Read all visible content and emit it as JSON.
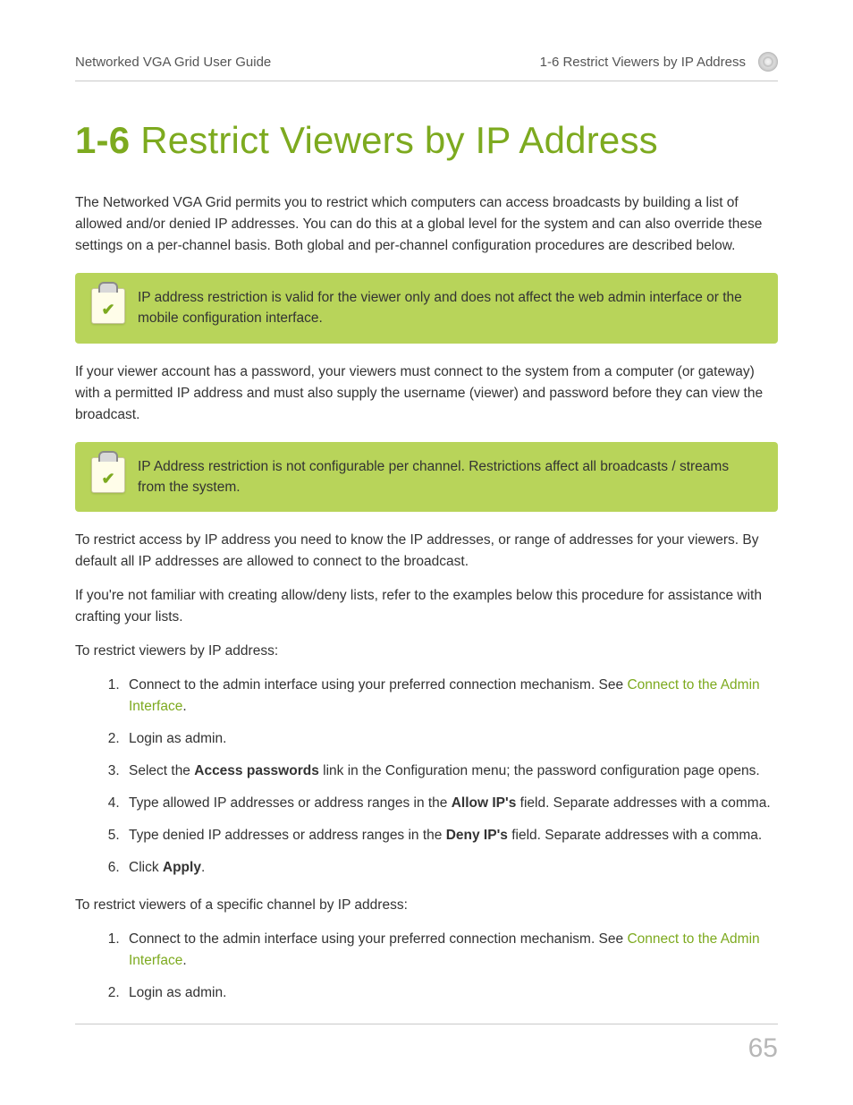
{
  "header": {
    "left": "Networked VGA Grid User Guide",
    "right": "1-6 Restrict Viewers by IP Address"
  },
  "title": {
    "number": "1-6",
    "text": "Restrict Viewers by IP Address"
  },
  "intro": "The Networked VGA Grid permits you to restrict which computers can access broadcasts by building a list of allowed and/or denied IP addresses. You can do this at a global level for the system and can also override these settings on a per-channel basis. Both global and per-channel configuration procedures are described below.",
  "note1": "IP address restriction is valid for the viewer only and does not affect the web admin interface or the mobile configuration interface.",
  "para2": "If your viewer account has a password, your viewers must connect to the system from a computer (or gateway) with a permitted IP address and must also supply the username (viewer) and password before they can view the broadcast.",
  "note2": "IP Address restriction is not configurable per channel. Restrictions affect all broadcasts / streams from the system.",
  "para3": "To restrict access by IP address you need to know the IP addresses, or range of addresses for your viewers. By default all IP addresses are allowed to connect to the broadcast.",
  "para4": "If you're not familiar with creating allow/deny lists, refer to the examples below this procedure for assistance with crafting your lists.",
  "lead1": "To restrict viewers by IP address:",
  "list1": {
    "i1a": "Connect to the admin interface using your preferred connection mechanism. See ",
    "i1link": "Connect to the Admin Interface",
    "i1b": ".",
    "i2": "Login as admin.",
    "i3a": "Select the ",
    "i3b": "Access passwords",
    "i3c": " link in the Configuration menu; the password configuration page opens.",
    "i4a": "Type allowed IP addresses or address ranges in the ",
    "i4b": "Allow IP's",
    "i4c": " field. Separate addresses with a comma.",
    "i5a": "Type denied IP addresses or address ranges in the ",
    "i5b": "Deny IP's",
    "i5c": " field. Separate addresses with a comma.",
    "i6a": "Click ",
    "i6b": "Apply",
    "i6c": "."
  },
  "lead2": "To restrict viewers of a specific channel by IP address:",
  "list2": {
    "i1a": "Connect to the admin interface using your preferred connection mechanism. See ",
    "i1link": "Connect to the Admin Interface",
    "i1b": ".",
    "i2": "Login as admin."
  },
  "page_number": "65"
}
